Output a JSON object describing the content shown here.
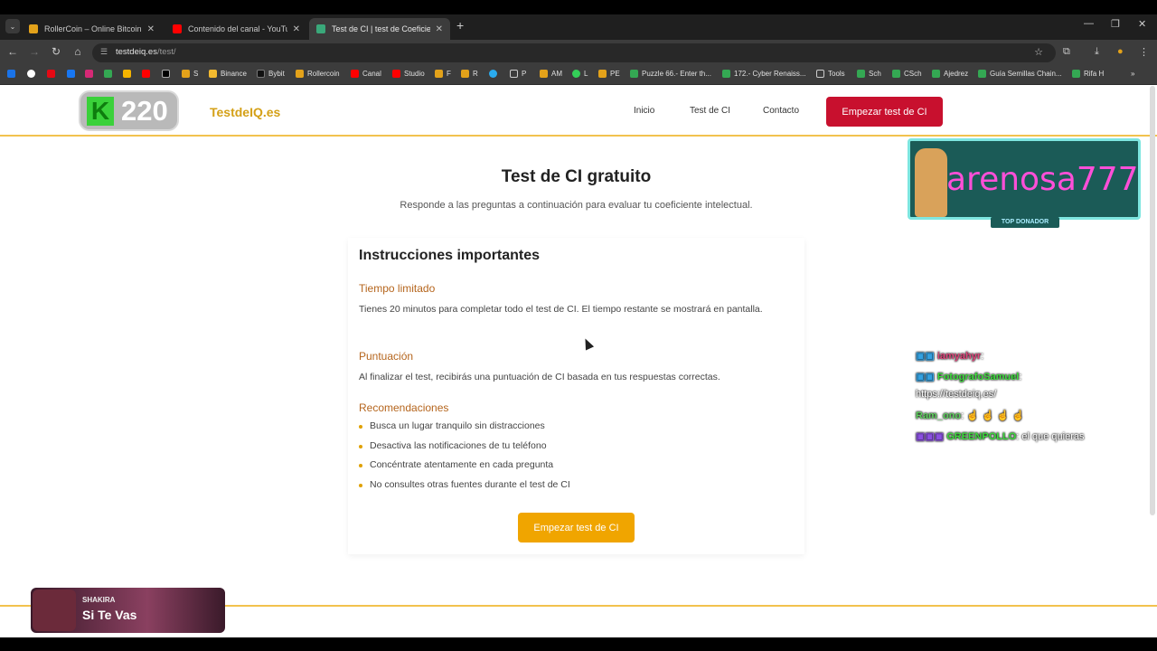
{
  "browser": {
    "tabs": [
      {
        "title": "RollerCoin – Online Bitcoin Mining",
        "color": "#e3a21a"
      },
      {
        "title": "Contenido del canal - YouTube",
        "color": "#ff0000"
      },
      {
        "title": "Test de CI | test de Coeficiente I",
        "color": "#3aa87a"
      }
    ],
    "new_tab": "+",
    "url_host": "testdeiq.es",
    "url_path": "/test/",
    "bookmarks": [
      "Binance",
      "Bybit",
      "Rollercoin",
      "Canal",
      "Studio",
      "F",
      "R",
      "P",
      "AM",
      "L",
      "PE",
      "Puzzle 66.- Enter th...",
      "172.- Cyber Renaiss...",
      "Tools",
      "Sch",
      "CSch",
      "Ajedrez",
      "Guía Semillas Chain...",
      "Rifa H"
    ]
  },
  "site": {
    "logo_number": "220",
    "logo_letter": "K",
    "brand": "TestdeIQ.es",
    "nav": [
      "Inicio",
      "Test de CI",
      "Contacto"
    ],
    "cta_header": "Empezar test de CI"
  },
  "main": {
    "title": "Test de CI gratuito",
    "subtitle": "Responde a las preguntas a continuación para evaluar tu coeficiente intelectual.",
    "instructions_title": "Instrucciones importantes",
    "time_head": "Tiempo limitado",
    "time_text": "Tienes 20 minutos para completar todo el test de CI. El tiempo restante se mostrará en pantalla.",
    "score_head": "Puntuación",
    "score_text": "Al finalizar el test, recibirás una puntuación de CI basada en tus respuestas correctas.",
    "rec_head": "Recomendaciones",
    "recommendations": [
      "Busca un lugar tranquilo sin distracciones",
      "Desactiva las notificaciones de tu teléfono",
      "Concéntrate atentamente en cada pregunta",
      "No consultes otras fuentes durante el test de CI"
    ],
    "cta_main": "Empezar test de CI"
  },
  "overlay": {
    "donor_name": "arenosa777",
    "donor_tag": "TOP DONADOR",
    "chat": [
      {
        "user": "iamyahyr",
        "msg": ":",
        "color": "#e0457b"
      },
      {
        "user": "FotografoSamuel",
        "msg": ":",
        "color": "#3ddc3d"
      },
      {
        "user": "",
        "msg": "https://testdeiq.es/",
        "color": "#ffffff"
      },
      {
        "user": "Ram_ono",
        "msg": ": ☝ ☝ ☝ ☝",
        "color": "#5ed15e"
      },
      {
        "user": "GREENPOLLO",
        "msg": ": el que quieras",
        "color": "#3ddc3d"
      }
    ],
    "song_artist": "SHAKIRA",
    "song_title": "Si Te Vas"
  }
}
